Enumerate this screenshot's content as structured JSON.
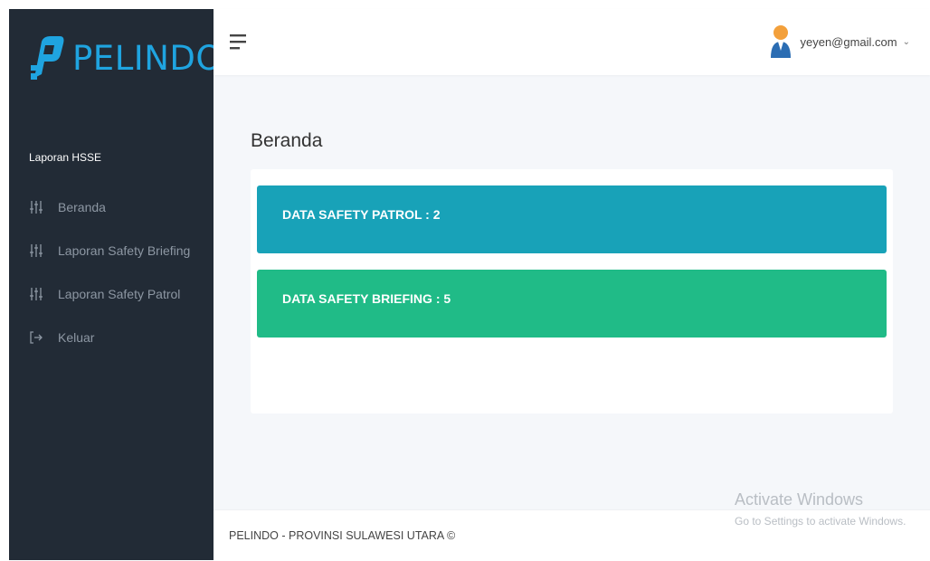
{
  "brand": {
    "name": "PELINDO",
    "color": "#1fa4e0"
  },
  "sidebar": {
    "section_title": "Laporan HSSE",
    "items": [
      {
        "label": "Beranda",
        "icon": "sliders-icon"
      },
      {
        "label": "Laporan Safety Briefing",
        "icon": "sliders-icon"
      },
      {
        "label": "Laporan Safety Patrol",
        "icon": "sliders-icon"
      },
      {
        "label": "Keluar",
        "icon": "logout-icon"
      }
    ]
  },
  "header": {
    "user_email": "yeyen@gmail.com",
    "caret": "⌄"
  },
  "main": {
    "title": "Beranda",
    "stats": [
      {
        "label": "DATA SAFETY PATROL : 2",
        "color": "#18a2b8"
      },
      {
        "label": "DATA SAFETY BRIEFING : 5",
        "color": "#20bb87"
      }
    ]
  },
  "watermark": {
    "title": "Activate Windows",
    "subtitle": "Go to Settings to activate Windows."
  },
  "footer": {
    "text": "PELINDO - PROVINSI SULAWESI UTARA ©"
  }
}
